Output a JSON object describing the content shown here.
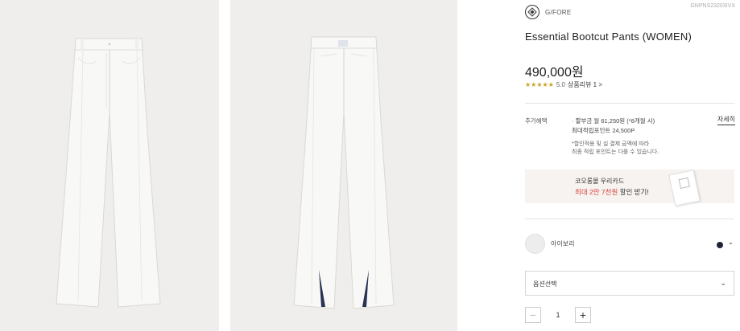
{
  "images": {
    "front_alt": "",
    "back_alt": ""
  },
  "product": {
    "brand": "G/FORE",
    "code": "GNPNS23203IVX",
    "title": "Essential Bootcut Pants (WOMEN)",
    "price": "490,000원",
    "stars": "★★★★★",
    "rating": "5.0",
    "review_link": "상품리뷰 1 >"
  },
  "benefits": {
    "label": "추가혜택",
    "installment": "· 할부금 월 61,250원 (*8개월 시)",
    "points": "최대적립포인트 24,500P",
    "note1": "*할인적용 및 실 결제 금액에 따라",
    "note2": "최종 적립 포인트는 다를 수 있습니다.",
    "detail": "자세히"
  },
  "card_promo": {
    "line1": "코오롱몰 우리카드",
    "line2_highlight": "최대 2만 7천원",
    "line2_rest": " 할인 받기!"
  },
  "color": {
    "label": "아이보리",
    "swatch": "#ededed",
    "alt_swatch": "#1e2336"
  },
  "option": {
    "placeholder": "옵션선택"
  },
  "quantity": {
    "minus": "−",
    "value": "1",
    "plus": "+"
  }
}
